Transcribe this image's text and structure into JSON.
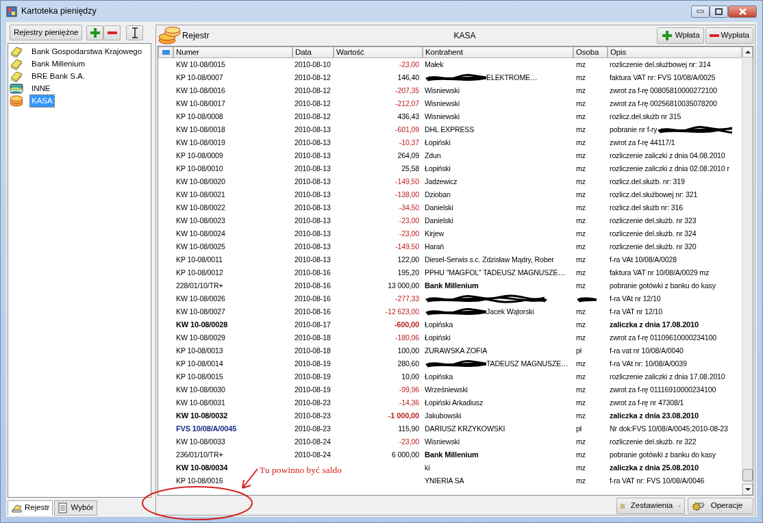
{
  "window": {
    "title": "Kartoteka pieniędzy"
  },
  "left_panel": {
    "header_button": "Rejestry pieniężne",
    "tool_buttons": [
      {
        "kind": "add"
      },
      {
        "kind": "remove"
      },
      {
        "kind": "cursor"
      }
    ],
    "registers": [
      {
        "label": "Bank Gospodarstwa Krajowego",
        "kind": "bank",
        "selected": false
      },
      {
        "label": "Bank Millenium",
        "kind": "bank",
        "selected": false
      },
      {
        "label": "BRE Bank S.A.",
        "kind": "bank",
        "selected": false
      },
      {
        "label": "INNE",
        "kind": "card",
        "selected": false
      },
      {
        "label": "KASA",
        "kind": "cash",
        "selected": true
      }
    ],
    "tabs": [
      {
        "label": "Rejestr",
        "kind": "register",
        "selected": true
      },
      {
        "label": "Wybór",
        "kind": "choice",
        "selected": false
      }
    ]
  },
  "register": {
    "title": "Rejestr",
    "name": "KASA",
    "buttons": [
      {
        "label": "Wpłata",
        "kind": "add"
      },
      {
        "label": "Wypłata",
        "kind": "remove"
      }
    ]
  },
  "table": {
    "columns": [
      "Numer",
      "Data",
      "Wartość",
      "Kontrahent",
      "Osoba",
      "Opis"
    ],
    "rows": [
      {
        "kind": "regular",
        "numer": "KW 10-08/0015",
        "data": "2010-08-10",
        "value": "-23,00",
        "negative": true,
        "contractor": "Małek",
        "person": "mz",
        "description": "rozliczenie del.służbowej nr: 314"
      },
      {
        "kind": "regular",
        "numer": "KP 10-08/0007",
        "data": "2010-08-12",
        "value": "146,40",
        "negative": false,
        "contractor": "ELEKTROME…",
        "person": "mz",
        "description": "faktura VAT nr: FVS 10/08/A/0025",
        "contractor_scribbled": true
      },
      {
        "kind": "regular",
        "numer": "KW 10-08/0016",
        "data": "2010-08-12",
        "value": "-207,35",
        "negative": true,
        "contractor": "Wisniewski",
        "person": "mz",
        "description": "zwrot za f-rę 00805810000272100"
      },
      {
        "kind": "regular",
        "numer": "KW 10-08/0017",
        "data": "2010-08-12",
        "value": "-212,07",
        "negative": true,
        "contractor": "Wisniewski",
        "person": "mz",
        "description": "zwrot za f-rę 00256810035078200"
      },
      {
        "kind": "regular",
        "numer": "KP 10-08/0008",
        "data": "2010-08-12",
        "value": "436,43",
        "negative": false,
        "contractor": "Wisniewski",
        "person": "mz",
        "description": "rozlicz.del.służb nr 315"
      },
      {
        "kind": "regular",
        "numer": "KW 10-08/0018",
        "data": "2010-08-13",
        "value": "-601,09",
        "negative": true,
        "contractor": "DHL EXPRESS",
        "person": "mz",
        "description": "pobranie nr f-ry",
        "description_scribbled": true
      },
      {
        "kind": "regular",
        "numer": "KW 10-08/0019",
        "data": "2010-08-13",
        "value": "-10,37",
        "negative": true,
        "contractor": "Łopiński",
        "person": "mz",
        "description": "zwrot za f-rę 44117/1"
      },
      {
        "kind": "regular",
        "numer": "KP 10-08/0009",
        "data": "2010-08-13",
        "value": "264,09",
        "negative": false,
        "contractor": "Zdun",
        "person": "mz",
        "description": "rozliczenie zaliczki z dnia 04.08.2010"
      },
      {
        "kind": "regular",
        "numer": "KP 10-08/0010",
        "data": "2010-08-13",
        "value": "25,58",
        "negative": false,
        "contractor": "Łopiński",
        "person": "mz",
        "description": "rozliczenie zaliczki z dnia 02.08.2010 r"
      },
      {
        "kind": "regular",
        "numer": "KW 10-08/0020",
        "data": "2010-08-13",
        "value": "-149,50",
        "negative": true,
        "contractor": "Jadzewicz",
        "person": "mz",
        "description": "rozlicz.del.służb. nr: 319"
      },
      {
        "kind": "regular",
        "numer": "KW 10-08/0021",
        "data": "2010-08-13",
        "value": "-138,00",
        "negative": true,
        "contractor": "Dzioban",
        "person": "mz",
        "description": "rozlicz.del.służbowej nr: 321"
      },
      {
        "kind": "regular",
        "numer": "KW 10-08/0022",
        "data": "2010-08-13",
        "value": "-34,50",
        "negative": true,
        "contractor": "Danielski",
        "person": "mz",
        "description": "rozlicz.del służb nr: 316"
      },
      {
        "kind": "regular",
        "numer": "KW 10-08/0023",
        "data": "2010-08-13",
        "value": "-23,00",
        "negative": true,
        "contractor": "Danielski",
        "person": "mz",
        "description": "rozliczenie del.służb. nr 323"
      },
      {
        "kind": "regular",
        "numer": "KW 10-08/0024",
        "data": "2010-08-13",
        "value": "-23,00",
        "negative": true,
        "contractor": "Kirjew",
        "person": "mz",
        "description": "rozliczenie del.służb. nr 324"
      },
      {
        "kind": "regular",
        "numer": "KW 10-08/0025",
        "data": "2010-08-13",
        "value": "-149,50",
        "negative": true,
        "contractor": "Harań",
        "person": "mz",
        "description": "rozliczenie del.służb. nr 320"
      },
      {
        "kind": "regular",
        "numer": "KP 10-08/0011",
        "data": "2010-08-13",
        "value": "122,00",
        "negative": false,
        "contractor": "Diesel-Serwis s.c. Zdzisław Mądry, Rober",
        "person": "mz",
        "description": "f-ra VAt 10/08/A/0028"
      },
      {
        "kind": "regular",
        "numer": "KP 10-08/0012",
        "data": "2010-08-16",
        "value": "195,20",
        "negative": false,
        "contractor": "PPHU \"MAGFOL\" TADEUSZ MAGNUSZE…",
        "person": "mz",
        "description": "faktura VAT nr 10/08/A/0029 mz"
      },
      {
        "kind": "transfer",
        "numer": "228/01/10/TR+",
        "data": "2010-08-16",
        "value": "13 000,00",
        "negative": false,
        "contractor": "Bank Millenium",
        "person": "mz",
        "description": "pobranie gotówki z banku do kasy"
      },
      {
        "kind": "regular",
        "numer": "KW 10-08/0026",
        "data": "2010-08-16",
        "value": "-277,33",
        "negative": true,
        "description": "f-ra VAt nr 12/10",
        "contractor_scribbled": true,
        "person_scribbled": true
      },
      {
        "kind": "regular",
        "numer": "KW 10-08/0027",
        "data": "2010-08-16",
        "value": "-12 623,00",
        "negative": true,
        "contractor": "Jacek Wątorski",
        "person": "mz",
        "description": "f-ra VAT nr 12/10",
        "contractor_scribbled": true
      },
      {
        "kind": "advance",
        "numer": "KW 10-08/0028",
        "data": "2010-08-17",
        "value": "-600,00",
        "negative": true,
        "contractor": "Łopińska",
        "person": "mz",
        "description": "zaliczka z dnia 17.08.2010"
      },
      {
        "kind": "regular",
        "numer": "KW 10-08/0029",
        "data": "2010-08-18",
        "value": "-180,06",
        "negative": true,
        "contractor": "Łopiński",
        "person": "mz",
        "description": "zwrot za f-rę 01109610000234100"
      },
      {
        "kind": "regular",
        "numer": "KP 10-08/0013",
        "data": "2010-08-18",
        "value": "100,00",
        "negative": false,
        "contractor": "ZURAWSKA ZOFIA",
        "person": "pł",
        "description": "f-ra vat nr 10/08/A/0040"
      },
      {
        "kind": "regular",
        "numer": "KP 10-08/0014",
        "data": "2010-08-19",
        "value": "280,60",
        "negative": false,
        "contractor": "TADEUSZ MAGNUSZE…",
        "person": "mz",
        "description": "f-ra VAt nr: 10/08/A/0039",
        "contractor_scribbled": true
      },
      {
        "kind": "regular",
        "numer": "KP 10-08/0015",
        "data": "2010-08-19",
        "value": "10,00",
        "negative": false,
        "contractor": "Łopińska",
        "person": "mz",
        "description": "rozliczenie zaliczki z dnia 17.08.2010"
      },
      {
        "kind": "regular",
        "numer": "KW 10-08/0030",
        "data": "2010-08-19",
        "value": "-99,96",
        "negative": true,
        "contractor": "Wrześniewski",
        "person": "mz",
        "description": "zwrot za f-rę 01116910000234100"
      },
      {
        "kind": "regular",
        "numer": "KW 10-08/0031",
        "data": "2010-08-23",
        "value": "-14,36",
        "negative": true,
        "contractor": "Łopiński Arkadiusz",
        "person": "mz",
        "description": "zwrot za f-rę nr 47308/1"
      },
      {
        "kind": "advance",
        "numer": "KW 10-08/0032",
        "data": "2010-08-23",
        "value": "-1 000,00",
        "negative": true,
        "contractor": "Jakubowski",
        "person": "mz",
        "description": "zaliczka z dnia 23.08.2010"
      },
      {
        "kind": "invoice",
        "numer": "FVS 10/08/A/0045",
        "data": "2010-08-23",
        "value": "115,90",
        "negative": false,
        "contractor": "DARIUSZ KRZYKOWSKI",
        "person": "pł",
        "description": "Nr dok:FVS 10/08/A/0045;2010-08-23"
      },
      {
        "kind": "regular",
        "numer": "KW 10-08/0033",
        "data": "2010-08-24",
        "value": "-23,00",
        "negative": true,
        "contractor": "Wisniewski",
        "person": "mz",
        "description": "rozliczenie del.służb. nr 322"
      },
      {
        "kind": "transfer",
        "numer": "236/01/10/TR+",
        "data": "2010-08-24",
        "value": "6 000,00",
        "negative": false,
        "contractor": "Bank Millenium",
        "person": "mz",
        "description": "pobranie gotówki z banku do kasy"
      },
      {
        "kind": "advance",
        "numer": "KW 10-08/0034",
        "contractor": "ki",
        "person": "mz",
        "description": "zaliczka z dnia 25.08.2010"
      },
      {
        "kind": "regular",
        "numer": "KP 10-08/0016",
        "contractor": "YNIERIA SA",
        "person": "mz",
        "description": "f-ra VAT nr: FVS 10/08/A/0046"
      }
    ]
  },
  "bottom_buttons": [
    {
      "label": "Zestawienia",
      "kind": "reports"
    },
    {
      "label": "Operacje",
      "kind": "operations"
    }
  ],
  "annotation": {
    "text": "Tu powinno być saldo"
  }
}
